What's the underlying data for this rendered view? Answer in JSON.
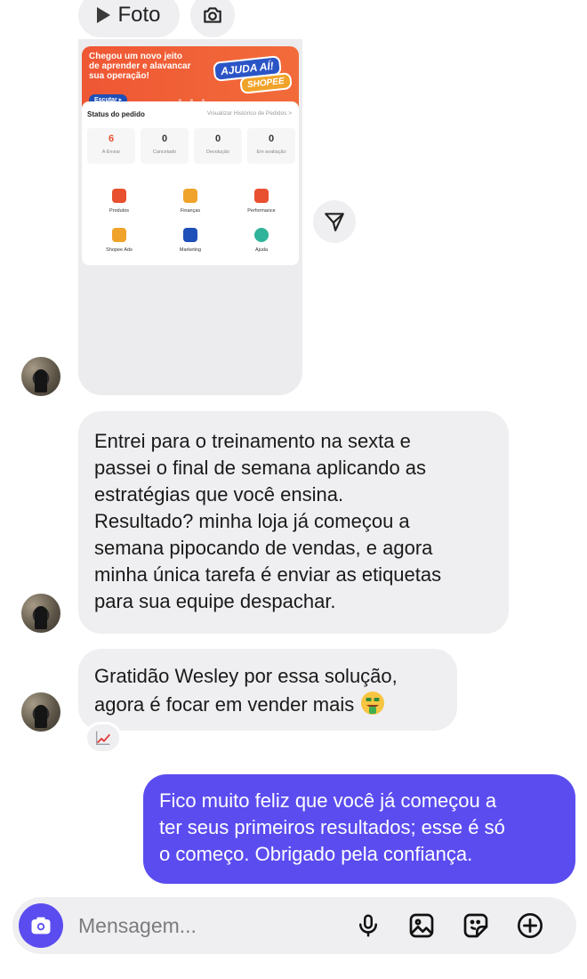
{
  "top_pills": {
    "foto_label": "Foto"
  },
  "shared_screenshot": {
    "banner": {
      "text_line1": "Chegou um novo jeito",
      "text_line2": "de aprender e alavancar",
      "text_line3": "sua operação!",
      "button_label": "Escutar ▸",
      "badge_line1": "AJUDA AÍ!",
      "badge_line2": "SHOPEE"
    },
    "status": {
      "title": "Status do pedido",
      "link": "Visualizar Histórico de Pedidos  >",
      "items": [
        {
          "value": "6",
          "label": "A Enviar"
        },
        {
          "value": "0",
          "label": "Cancelado"
        },
        {
          "value": "0",
          "label": "Devolução"
        },
        {
          "value": "0",
          "label": "Em avaliação"
        }
      ]
    },
    "menu": [
      {
        "label": "Produtos",
        "color": "#e8502f"
      },
      {
        "label": "Finanças",
        "color": "#f0a32a"
      },
      {
        "label": "Performance",
        "color": "#e8502f"
      },
      {
        "label": "Shopee Ads",
        "color": "#f0a32a"
      },
      {
        "label": "Marketing",
        "color": "#1f4fb8"
      },
      {
        "label": "Ajuda",
        "color": "#2fb39a"
      }
    ]
  },
  "messages": [
    {
      "direction": "incoming",
      "lines": [
        "Entrei para o treinamento na sexta e",
        "passei o final de semana aplicando as",
        "estratégias que você ensina.",
        "Resultado? minha loja já começou a",
        "semana pipocando de vendas, e agora",
        "minha única tarefa é enviar as etiquetas",
        "para sua equipe despachar."
      ]
    },
    {
      "direction": "incoming",
      "lines": [
        "Gratidão Wesley por essa solução,",
        "agora é focar em vender mais"
      ],
      "emoji": "money-mouth-face",
      "reaction": "chart-increasing"
    },
    {
      "direction": "outgoing",
      "lines": [
        "Fico muito feliz que você já começou a",
        "ter seus primeiros resultados; esse é só",
        "o começo. Obrigado pela confiança."
      ]
    }
  ],
  "composer": {
    "placeholder": "Mensagem...",
    "icons": [
      "camera-icon",
      "microphone-icon",
      "gallery-icon",
      "sticker-icon",
      "plus-icon"
    ]
  },
  "colors": {
    "outgoing_bubble": "#5b4cf0",
    "incoming_bubble": "#efeff1",
    "shopee_orange": "#ef5734"
  }
}
